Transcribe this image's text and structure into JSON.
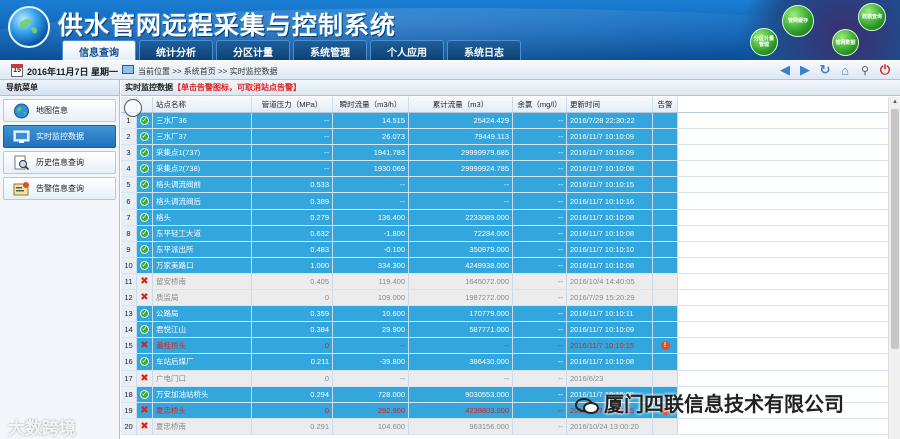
{
  "app": {
    "title": "供水管网远程采集与控制系统",
    "nav": [
      "信息查询",
      "统计分析",
      "分区计量",
      "系统管理",
      "个人应用",
      "系统日志"
    ],
    "active_nav": 0,
    "deco_bubbles": [
      "管网缓存",
      "数据查询",
      "分区计量\n管理",
      "管网数据"
    ]
  },
  "infobar": {
    "calendar_day": "15",
    "date": "2016年11月7日 星期一",
    "location": "当前位置  >> 系统首页  >> 实时监控数据",
    "toolbar_icons": [
      "arrow-left-icon",
      "arrow-right-icon",
      "refresh-icon",
      "home-icon",
      "search-icon",
      "power-icon"
    ]
  },
  "sidebar": {
    "title": "导航菜单",
    "items": [
      {
        "label": "地图信息",
        "icon": "globe-icon"
      },
      {
        "label": "实时监控数据",
        "icon": "monitor-icon",
        "active": true
      },
      {
        "label": "历史信息查询",
        "icon": "magnifier-icon"
      },
      {
        "label": "告警信息查询",
        "icon": "alarm-list-icon"
      }
    ]
  },
  "panel": {
    "title": "实时监控数据",
    "hint": "【单击告警图标，可取消站点告警】"
  },
  "table": {
    "headers": [
      "站点名称",
      "管道压力（MPa）",
      "瞬时流量（m3/h）",
      "累计流量（m3）",
      "余氯（mg/l）",
      "更新时间",
      "告警"
    ],
    "rows": [
      {
        "no": "1",
        "status": "ok",
        "name": "三水厂36",
        "pressure": "--",
        "flow": "14.515",
        "total": "25424.429",
        "chlorine": "--",
        "time": "2016/7/28 22:30:22",
        "alarm": false
      },
      {
        "no": "2",
        "status": "ok",
        "name": "三水厂37",
        "pressure": "--",
        "flow": "26.073",
        "total": "79449.113",
        "chlorine": "--",
        "time": "2016/11/7 10:10:09",
        "alarm": false
      },
      {
        "no": "3",
        "status": "ok",
        "name": "采集点1(737)",
        "pressure": "--",
        "flow": "1941.783",
        "total": "29999979.685",
        "chlorine": "--",
        "time": "2016/11/7 10:10:09",
        "alarm": false
      },
      {
        "no": "4",
        "status": "ok",
        "name": "采集点2(738)",
        "pressure": "--",
        "flow": "1930.069",
        "total": "29999924.785",
        "chlorine": "--",
        "time": "2016/11/7 10:10:08",
        "alarm": false
      },
      {
        "no": "5",
        "status": "ok",
        "name": "格头调流阀前",
        "pressure": "0.533",
        "flow": "--",
        "total": "--",
        "chlorine": "--",
        "time": "2016/11/7 10:10:15",
        "alarm": false
      },
      {
        "no": "6",
        "status": "ok",
        "name": "格头调流阀后",
        "pressure": "0.389",
        "flow": "--",
        "total": "--",
        "chlorine": "--",
        "time": "2016/11/7 10:10:16",
        "alarm": false
      },
      {
        "no": "7",
        "status": "ok",
        "name": "格头",
        "pressure": "0.279",
        "flow": "136.400",
        "total": "2233089.000",
        "chlorine": "--",
        "time": "2016/11/7 10:10:08",
        "alarm": false
      },
      {
        "no": "8",
        "status": "ok",
        "name": "东平轻工大道",
        "pressure": "0.632",
        "flow": "-1.800",
        "total": "72284.000",
        "chlorine": "--",
        "time": "2016/11/7 10:10:08",
        "alarm": false
      },
      {
        "no": "9",
        "status": "ok",
        "name": "东平派出所",
        "pressure": "0.483",
        "flow": "-0.100",
        "total": "350979.000",
        "chlorine": "--",
        "time": "2016/11/7 10:10:10",
        "alarm": false
      },
      {
        "no": "10",
        "status": "ok",
        "name": "万家美路口",
        "pressure": "1.000",
        "flow": "334.300",
        "total": "4249938.000",
        "chlorine": "--",
        "time": "2016/11/7 10:10:08",
        "alarm": false
      },
      {
        "no": "11",
        "status": "off",
        "name": "留安桥南",
        "pressure": "0.405",
        "flow": "119.400",
        "total": "1645072.000",
        "chlorine": "--",
        "time": "2016/10/4 14:40:05",
        "alarm": false
      },
      {
        "no": "12",
        "status": "off",
        "name": "质监局",
        "pressure": "0",
        "flow": "109.000",
        "total": "1987272.000",
        "chlorine": "--",
        "time": "2016/7/29 15:20:29",
        "alarm": false
      },
      {
        "no": "13",
        "status": "ok",
        "name": "公路局",
        "pressure": "0.359",
        "flow": "10.600",
        "total": "170779.000",
        "chlorine": "--",
        "time": "2016/11/7 10:10:11",
        "alarm": false
      },
      {
        "no": "14",
        "status": "ok",
        "name": "君悦江山",
        "pressure": "0.384",
        "flow": "29.900",
        "total": "587771.000",
        "chlorine": "--",
        "time": "2016/11/7 10:10:09",
        "alarm": false
      },
      {
        "no": "15",
        "status": "alarm",
        "name": "莆桂桥头",
        "pressure": "0",
        "flow": "--",
        "total": "--",
        "chlorine": "--",
        "time": "2016/11/7 10:10:15",
        "alarm": true
      },
      {
        "no": "16",
        "status": "ok",
        "name": "车站后煤厂",
        "pressure": "0.211",
        "flow": "-39.800",
        "total": "386430.000",
        "chlorine": "--",
        "time": "2016/11/7 10:10:08",
        "alarm": false
      },
      {
        "no": "17",
        "status": "off",
        "name": "广电门口",
        "pressure": "0",
        "flow": "--",
        "total": "--",
        "chlorine": "--",
        "time": "2016/6/23",
        "alarm": false
      },
      {
        "no": "18",
        "status": "ok",
        "name": "万安加油站桥头",
        "pressure": "0.294",
        "flow": "728.000",
        "total": "9030553.000",
        "chlorine": "--",
        "time": "2016/11/7 10:10:09",
        "alarm": false
      },
      {
        "no": "19",
        "status": "alarm",
        "name": "夏忠桥头",
        "pressure": "0",
        "flow": "292.900",
        "total": "4239803.000",
        "chlorine": "--",
        "time": "2016/11/7 10:10:15",
        "alarm": true
      },
      {
        "no": "20",
        "status": "off",
        "name": "夏忠桥南",
        "pressure": "0.291",
        "flow": "104.600",
        "total": "963156.000",
        "chlorine": "--",
        "time": "2016/10/24 13:00:20",
        "alarm": false
      }
    ]
  },
  "watermarks": {
    "left": "大数跨境",
    "right": "厦门四联信息技术有限公司"
  },
  "colors": {
    "banner": "#0f63b6",
    "row_ok": "#33a6dd",
    "row_off": "#ececec",
    "alarm_text": "#e02020",
    "status_ok": "#3eaa3e",
    "status_bad": "#d42424"
  }
}
